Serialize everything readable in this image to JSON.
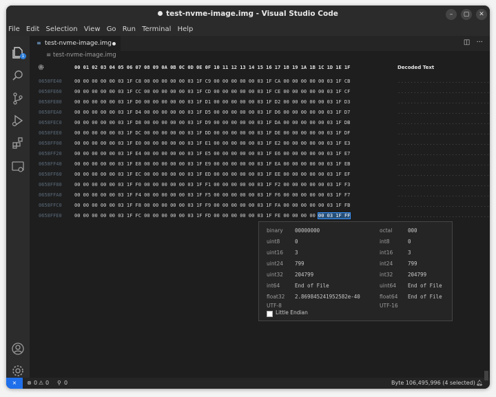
{
  "window": {
    "title": "test-nvme-image.img - Visual Studio Code"
  },
  "window_controls": {
    "minimize": "–",
    "maximize": "▢",
    "close": "✕"
  },
  "menu": [
    "File",
    "Edit",
    "Selection",
    "View",
    "Go",
    "Run",
    "Terminal",
    "Help"
  ],
  "activity_bar": {
    "explorer_badge": "1",
    "icons": [
      "explorer-icon",
      "search-icon",
      "source-control-icon",
      "run-debug-icon",
      "extensions-icon",
      "remote-explorer-icon",
      "account-icon",
      "manage-gear-icon"
    ]
  },
  "tab": {
    "label": "test-nvme-image.img",
    "icon": "file-icon"
  },
  "breadcrumb": {
    "file": "test-nvme-image.img"
  },
  "hex_header": {
    "columns": "00 01 02 03 04 05 06 07 08 09 0A 0B 0C 0D 0E 0F 10 11 12 13 14 15 16 17 18 19 1A 1B 1C 1D 1E 1F",
    "decoded_label": "Decoded Text"
  },
  "hex_rows": [
    {
      "addr": "0658FE40",
      "bytes": "00 00 00 00 00 03 1F C8 00 00 00 00 00 03 1F C9 00 00 00 00 00 03 1F CA 00 00 00 00 00 03 1F CB",
      "decoded": "................................"
    },
    {
      "addr": "0658FE60",
      "bytes": "00 00 00 00 00 03 1F CC 00 00 00 00 00 03 1F CD 00 00 00 00 00 03 1F CE 00 00 00 00 00 03 1F CF",
      "decoded": "................................"
    },
    {
      "addr": "0658FE80",
      "bytes": "00 00 00 00 00 03 1F D0 00 00 00 00 00 03 1F D1 00 00 00 00 00 03 1F D2 00 00 00 00 00 03 1F D3",
      "decoded": "................................"
    },
    {
      "addr": "0658FEA0",
      "bytes": "00 00 00 00 00 03 1F D4 00 00 00 00 00 03 1F D5 00 00 00 00 00 03 1F D6 00 00 00 00 00 03 1F D7",
      "decoded": "................................"
    },
    {
      "addr": "0658FEC0",
      "bytes": "00 00 00 00 00 03 1F D8 00 00 00 00 00 03 1F D9 00 00 00 00 00 03 1F DA 00 00 00 00 00 03 1F DB",
      "decoded": "................................"
    },
    {
      "addr": "0658FEE0",
      "bytes": "00 00 00 00 00 03 1F DC 00 00 00 00 00 03 1F DD 00 00 00 00 00 03 1F DE 00 00 00 00 00 03 1F DF",
      "decoded": "................................"
    },
    {
      "addr": "0658FF00",
      "bytes": "00 00 00 00 00 03 1F E0 00 00 00 00 00 03 1F E1 00 00 00 00 00 03 1F E2 00 00 00 00 00 03 1F E3",
      "decoded": "................................"
    },
    {
      "addr": "0658FF20",
      "bytes": "00 00 00 00 00 03 1F E4 00 00 00 00 00 03 1F E5 00 00 00 00 00 03 1F E6 00 00 00 00 00 03 1F E7",
      "decoded": "................................"
    },
    {
      "addr": "0658FF40",
      "bytes": "00 00 00 00 00 03 1F E8 00 00 00 00 00 03 1F E9 00 00 00 00 00 03 1F EA 00 00 00 00 00 03 1F EB",
      "decoded": "................................"
    },
    {
      "addr": "0658FF60",
      "bytes": "00 00 00 00 00 03 1F EC 00 00 00 00 00 03 1F ED 00 00 00 00 00 03 1F EE 00 00 00 00 00 03 1F EF",
      "decoded": "................................"
    },
    {
      "addr": "0658FF80",
      "bytes": "00 00 00 00 00 03 1F F0 00 00 00 00 00 03 1F F1 00 00 00 00 00 03 1F F2 00 00 00 00 00 03 1F F3",
      "decoded": "................................"
    },
    {
      "addr": "0658FFA0",
      "bytes": "00 00 00 00 00 03 1F F4 00 00 00 00 00 03 1F F5 00 00 00 00 00 03 1F F6 00 00 00 00 00 03 1F F7",
      "decoded": "................................"
    },
    {
      "addr": "0658FFC0",
      "bytes": "00 00 00 00 00 03 1F F8 00 00 00 00 00 03 1F F9 00 00 00 00 00 03 1F FA 00 00 00 00 00 03 1F FB",
      "decoded": "................................"
    },
    {
      "addr": "0658FFE0",
      "bytes": "00 00 00 00 00 03 1F FC 00 00 00 00 00 03 1F FD 00 00 00 00 00 03 1F FE 00 00 00 00 ",
      "bytes_selected": "00 03 1F FF",
      "decoded": "................................"
    }
  ],
  "data_inspector": {
    "binary": {
      "label": "binary",
      "value": "00000000"
    },
    "octal": {
      "label": "octal",
      "value": "000"
    },
    "uint8": {
      "label": "uint8",
      "value": "0"
    },
    "int8": {
      "label": "int8",
      "value": "0"
    },
    "uint16": {
      "label": "uint16",
      "value": "3"
    },
    "int16": {
      "label": "int16",
      "value": "3"
    },
    "uint24": {
      "label": "uint24",
      "value": "799"
    },
    "int24": {
      "label": "int24",
      "value": "799"
    },
    "uint32": {
      "label": "uint32",
      "value": "204799"
    },
    "int32": {
      "label": "int32",
      "value": "204799"
    },
    "int64": {
      "label": "int64",
      "value": "End of File"
    },
    "uint64": {
      "label": "uint64",
      "value": "End of File"
    },
    "float32": {
      "label": "float32",
      "value": "2.869845241952582e-40"
    },
    "float64": {
      "label": "float64",
      "value": "End of File"
    },
    "utf8": {
      "label": "UTF-8",
      "value": ""
    },
    "utf16": {
      "label": "UTF-16",
      "value": "\u0003"
    },
    "little_endian_label": "Little Endian",
    "little_endian_checked": false
  },
  "status_bar": {
    "errors": "0",
    "warnings": "0",
    "ports": "0",
    "byte_info": "Byte 106,495,996 (4 selected)"
  },
  "colors": {
    "accent": "#1f6feb",
    "selection": "#264f78",
    "badge": "#2f7ed8"
  }
}
